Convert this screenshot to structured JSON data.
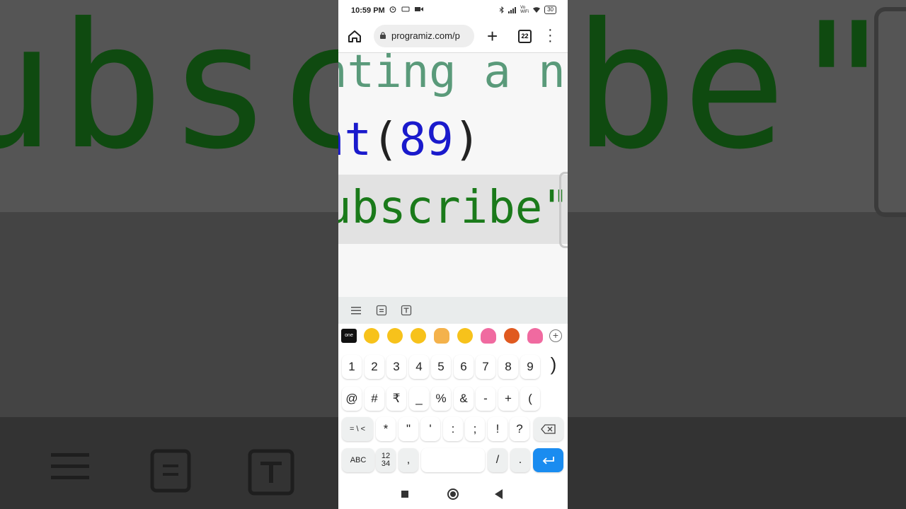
{
  "statusbar": {
    "time": "10:59 PM",
    "network_label": "Vo WiFi",
    "battery": "30"
  },
  "browser": {
    "url": "programiz.com/p",
    "tab_count": "22"
  },
  "code": {
    "comment": "nting a n",
    "call_name": "nt",
    "open_paren": "(",
    "number": "89",
    "close_paren": ")",
    "string_line": "ubscribe\""
  },
  "background": {
    "left_text": "ubsc",
    "right_text": "be\""
  },
  "emoji_bar": {
    "app_label": "one"
  },
  "keyboard": {
    "row1": [
      "1",
      "2",
      "3",
      "4",
      "5",
      "6",
      "7",
      "8",
      "9"
    ],
    "row1_extra": ")",
    "row2": [
      "@",
      "#",
      "₹",
      "_",
      "%",
      "&",
      "-",
      "+",
      "("
    ],
    "row3_first": "= \\ <",
    "row3": [
      "*",
      "\"",
      "'",
      ":",
      ";",
      "!",
      "?"
    ],
    "row4_abc": "ABC",
    "row4_num_top": "12",
    "row4_num_bottom": "34",
    "row4_comma": ",",
    "row4_slash": "/",
    "row4_dot": "."
  },
  "colors": {
    "comment": "#5a9a7a",
    "number": "#1a1acc",
    "string": "#1a7a1a",
    "enter_key": "#1a8cf0"
  }
}
